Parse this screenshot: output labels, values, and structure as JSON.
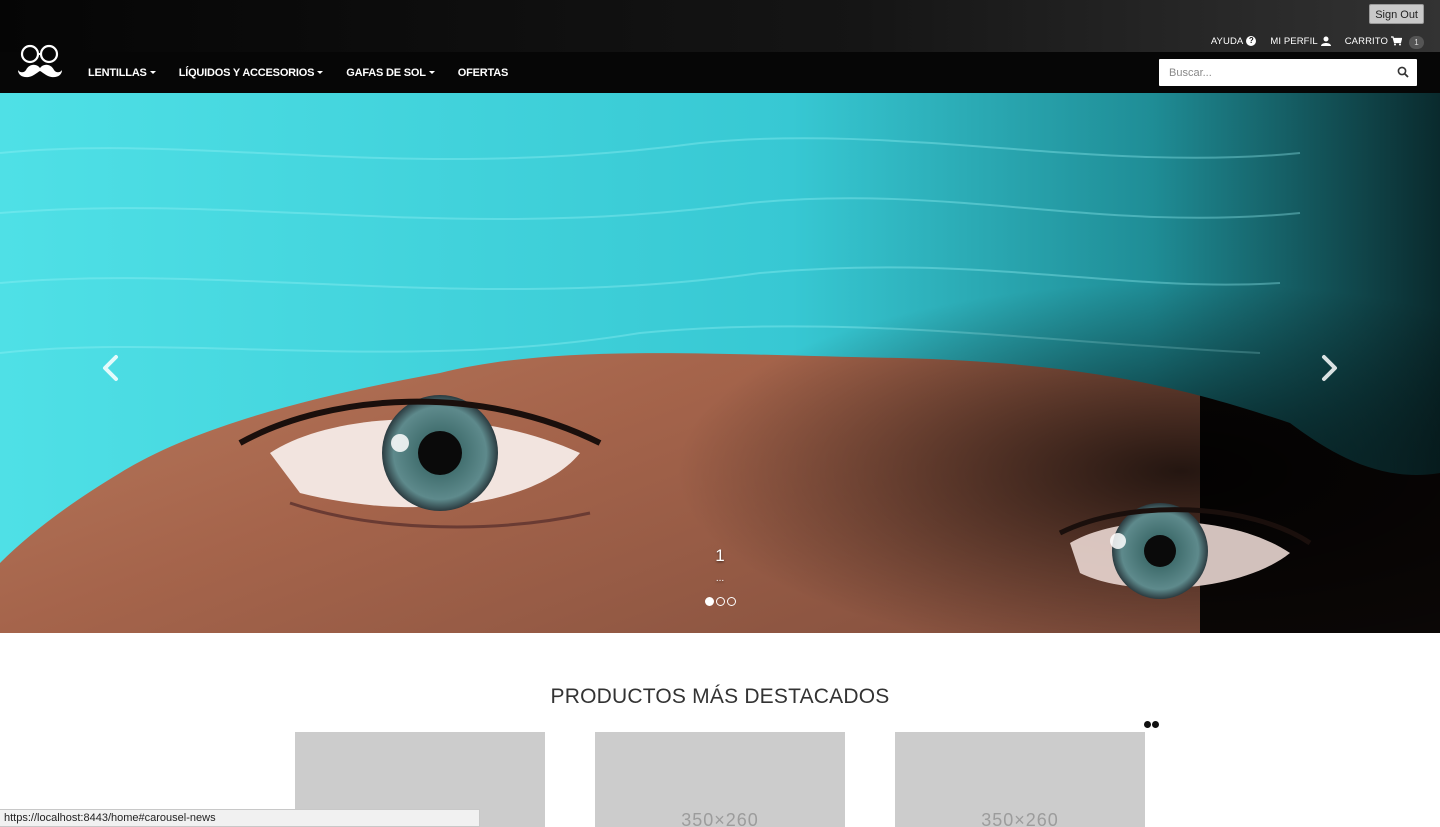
{
  "topbar": {
    "sign_out_label": "Sign Out",
    "help_label": "AYUDA",
    "profile_label": "MI PERFIL",
    "cart_label": "CARRITO",
    "cart_count": "1"
  },
  "nav": {
    "items": [
      {
        "label": "LENTILLAS",
        "dropdown": true
      },
      {
        "label": "LÍQUIDOS Y ACCESORIOS",
        "dropdown": true
      },
      {
        "label": "GAFAS DE SOL",
        "dropdown": true
      },
      {
        "label": "OFERTAS",
        "dropdown": false
      }
    ],
    "search_placeholder": "Buscar..."
  },
  "carousel": {
    "slide_title": "1",
    "slide_text": "...",
    "active_index": 0,
    "slide_count": 3
  },
  "featured": {
    "title": "PRODUCTOS MÁS DESTACADOS",
    "products": [
      {
        "placeholder": ""
      },
      {
        "placeholder": "350×260"
      },
      {
        "placeholder": "350×260"
      }
    ]
  },
  "status_bar": {
    "url": "https://localhost:8443/home#carousel-news"
  },
  "colors": {
    "navbar": "#060606",
    "hero_scarf": "#3fd4dc",
    "placeholder_gray": "#cccccc"
  }
}
